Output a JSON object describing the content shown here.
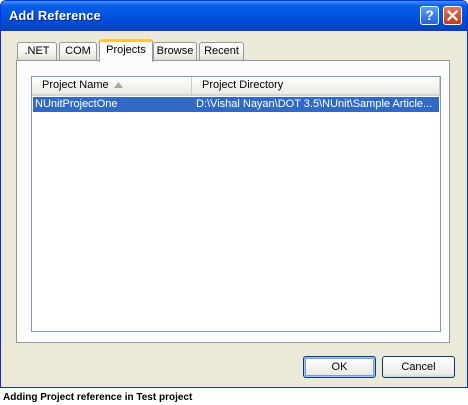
{
  "dialog": {
    "title": "Add Reference",
    "help_symbol": "?",
    "tabs": [
      ".NET",
      "COM",
      "Projects",
      "Browse",
      "Recent"
    ],
    "active_tab": "Projects",
    "list": {
      "columns": [
        "Project Name",
        "Project Directory"
      ],
      "sort_column": "Project Name",
      "rows": [
        {
          "name": "NUnitProjectOne",
          "directory": "D:\\Vishal Nayan\\DOT 3.5\\NUnit\\Sample Article..."
        }
      ]
    },
    "buttons": {
      "ok": "OK",
      "cancel": "Cancel"
    }
  },
  "caption": "Adding Project reference in Test project",
  "colors": {
    "titlebar": "#0054e3",
    "selection": "#316ac5",
    "dialog_bg": "#ece9d8",
    "active_tab_accent": "#ffc83c"
  }
}
